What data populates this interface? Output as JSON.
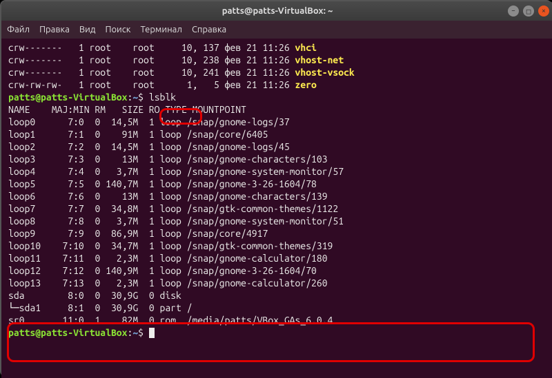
{
  "window": {
    "title": "patts@patts-VirtualBox: ~"
  },
  "menu": {
    "file": "Файл",
    "edit": "Правка",
    "view": "Вид",
    "search": "Поиск",
    "terminal": "Терминал",
    "help": "Справка"
  },
  "prompt": {
    "userhost": "patts@patts-VirtualBox",
    "sep": ":",
    "path": "~",
    "dollar": "$"
  },
  "commands": {
    "lsblk": "lsblk"
  },
  "dev_lines": [
    {
      "perm": "crw-------",
      "n": "1",
      "o": "root",
      "g": "root",
      "maj": "10,",
      "min": "137",
      "mon": "фев",
      "d": "21",
      "t": "11:26",
      "name": "vhci"
    },
    {
      "perm": "crw-------",
      "n": "1",
      "o": "root",
      "g": "root",
      "maj": "10,",
      "min": "238",
      "mon": "фев",
      "d": "21",
      "t": "11:26",
      "name": "vhost-net"
    },
    {
      "perm": "crw-------",
      "n": "1",
      "o": "root",
      "g": "root",
      "maj": "10,",
      "min": "241",
      "mon": "фев",
      "d": "21",
      "t": "11:26",
      "name": "vhost-vsock"
    },
    {
      "perm": "crw-rw-rw-",
      "n": "1",
      "o": "root",
      "g": "root",
      "maj": "1,",
      "min": "5",
      "mon": "фев",
      "d": "21",
      "t": "11:26",
      "name": "zero"
    }
  ],
  "lsblk_header": "NAME    MAJ:MIN RM   SIZE RO TYPE MOUNTPOINT",
  "lsblk_rows": [
    {
      "name": "loop0",
      "mm": "7:0",
      "rm": "0",
      "size": "14,5M",
      "ro": "1",
      "type": "loop",
      "mp": "/snap/gnome-logs/37"
    },
    {
      "name": "loop1",
      "mm": "7:1",
      "rm": "0",
      "size": "91M",
      "ro": "1",
      "type": "loop",
      "mp": "/snap/core/6405"
    },
    {
      "name": "loop2",
      "mm": "7:2",
      "rm": "0",
      "size": "14,5M",
      "ro": "1",
      "type": "loop",
      "mp": "/snap/gnome-logs/45"
    },
    {
      "name": "loop3",
      "mm": "7:3",
      "rm": "0",
      "size": "13M",
      "ro": "1",
      "type": "loop",
      "mp": "/snap/gnome-characters/103"
    },
    {
      "name": "loop4",
      "mm": "7:4",
      "rm": "0",
      "size": "3,7M",
      "ro": "1",
      "type": "loop",
      "mp": "/snap/gnome-system-monitor/57"
    },
    {
      "name": "loop5",
      "mm": "7:5",
      "rm": "0",
      "size": "140,7M",
      "ro": "1",
      "type": "loop",
      "mp": "/snap/gnome-3-26-1604/78"
    },
    {
      "name": "loop6",
      "mm": "7:6",
      "rm": "0",
      "size": "13M",
      "ro": "1",
      "type": "loop",
      "mp": "/snap/gnome-characters/139"
    },
    {
      "name": "loop7",
      "mm": "7:7",
      "rm": "0",
      "size": "34,8M",
      "ro": "1",
      "type": "loop",
      "mp": "/snap/gtk-common-themes/1122"
    },
    {
      "name": "loop8",
      "mm": "7:8",
      "rm": "0",
      "size": "3,7M",
      "ro": "1",
      "type": "loop",
      "mp": "/snap/gnome-system-monitor/51"
    },
    {
      "name": "loop9",
      "mm": "7:9",
      "rm": "0",
      "size": "86,9M",
      "ro": "1",
      "type": "loop",
      "mp": "/snap/core/4917"
    },
    {
      "name": "loop10",
      "mm": "7:10",
      "rm": "0",
      "size": "34,7M",
      "ro": "1",
      "type": "loop",
      "mp": "/snap/gtk-common-themes/319"
    },
    {
      "name": "loop11",
      "mm": "7:11",
      "rm": "0",
      "size": "2,3M",
      "ro": "1",
      "type": "loop",
      "mp": "/snap/gnome-calculator/180"
    },
    {
      "name": "loop12",
      "mm": "7:12",
      "rm": "0",
      "size": "140,9M",
      "ro": "1",
      "type": "loop",
      "mp": "/snap/gnome-3-26-1604/70"
    },
    {
      "name": "loop13",
      "mm": "7:13",
      "rm": "0",
      "size": "2,3M",
      "ro": "1",
      "type": "loop",
      "mp": "/snap/gnome-calculator/260"
    },
    {
      "name": "sda",
      "mm": "8:0",
      "rm": "0",
      "size": "30,9G",
      "ro": "0",
      "type": "disk",
      "mp": ""
    },
    {
      "name": "└─sda1",
      "mm": "8:1",
      "rm": "0",
      "size": "30,9G",
      "ro": "0",
      "type": "part",
      "mp": "/"
    },
    {
      "name": "sr0",
      "mm": "11:0",
      "rm": "1",
      "size": "82M",
      "ro": "0",
      "type": "rom",
      "mp": "/media/patts/VBox_GAs_6.0.4"
    }
  ]
}
